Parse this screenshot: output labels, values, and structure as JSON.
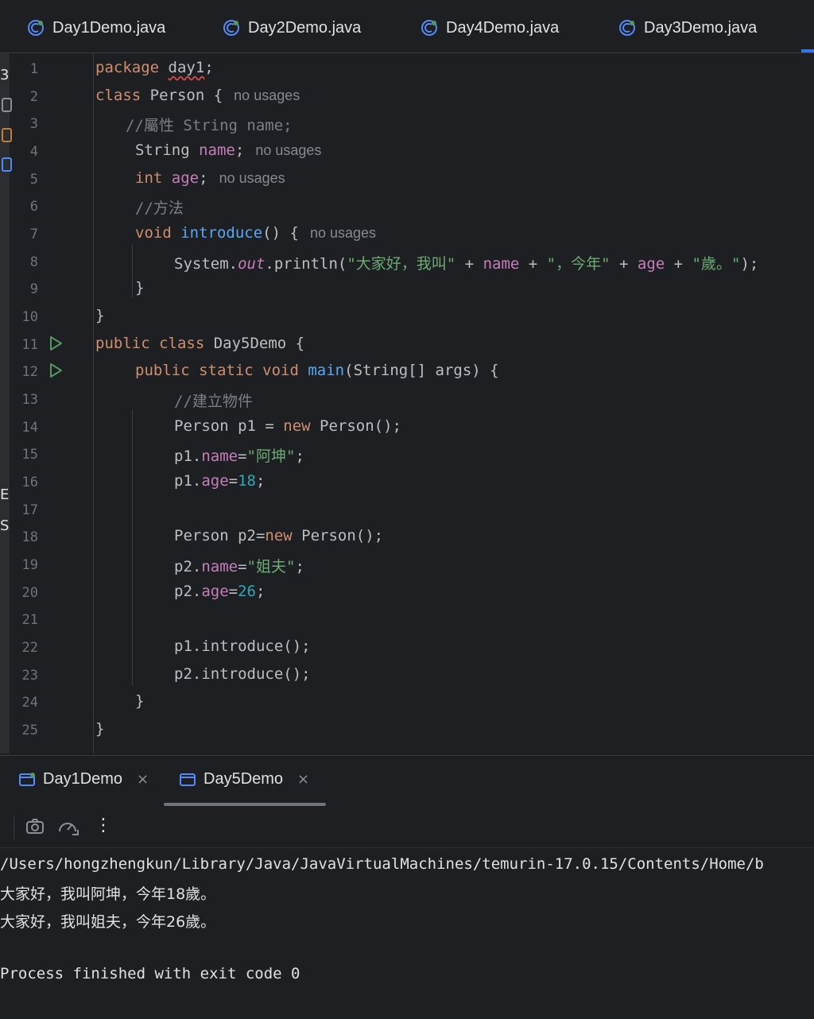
{
  "editor_tabs": [
    {
      "label": "Day1Demo.java"
    },
    {
      "label": "Day2Demo.java"
    },
    {
      "label": "Day4Demo.java"
    },
    {
      "label": "Day3Demo.java"
    }
  ],
  "left_strip": [
    "3",
    "E",
    "S"
  ],
  "code": {
    "line_numbers": [
      "1",
      "2",
      "3",
      "4",
      "5",
      "6",
      "7",
      "8",
      "9",
      "10",
      "11",
      "12",
      "13",
      "14",
      "15",
      "16",
      "17",
      "18",
      "19",
      "20",
      "21",
      "22",
      "23",
      "24",
      "25"
    ],
    "l1": {
      "kw": "package",
      "pkg": "day1",
      "end": ";"
    },
    "l2": {
      "kw": "class",
      "name": "Person {",
      "hint": "no usages"
    },
    "l3": {
      "comment": "//屬性 String name;"
    },
    "l4": {
      "type": "String",
      "field": "name",
      "end": ";",
      "hint": "no usages"
    },
    "l5": {
      "type": "int",
      "field": "age",
      "end": ";",
      "hint": "no usages"
    },
    "l6": {
      "comment": "//方法"
    },
    "l7": {
      "kw": "void",
      "method": "introduce",
      "rest": "() {",
      "hint": "no usages"
    },
    "l8": {
      "sys": "System.",
      "out": "out",
      "println": ".println(",
      "s1": "\"大家好，我叫\"",
      "plus1": " + ",
      "f1": "name",
      "plus2": " + ",
      "s2": "\"，今年\"",
      "plus3": " + ",
      "f2": "age",
      "plus4": " + ",
      "s3": "\"歲。\"",
      "end": ");"
    },
    "l9": {
      "text": "}"
    },
    "l10": {
      "text": "}"
    },
    "l11": {
      "kw": "public class",
      "name": "Day5Demo {"
    },
    "l12": {
      "kw": "public static void",
      "method": "main",
      "rest": "(String[] args) {"
    },
    "l13": {
      "comment": "//建立物件"
    },
    "l14": {
      "a": "Person p1 = ",
      "kw": "new",
      "b": " Person();"
    },
    "l15": {
      "a": "p1.",
      "field": "name",
      "eq": "=",
      "str": "\"阿坤\"",
      "end": ";"
    },
    "l16": {
      "a": "p1.",
      "field": "age",
      "eq": "=",
      "num": "18",
      "end": ";"
    },
    "l18": {
      "a": "Person p2=",
      "kw": "new",
      "b": " Person();"
    },
    "l19": {
      "a": "p2.",
      "field": "name",
      "eq": "=",
      "str": "\"姐夫\"",
      "end": ";"
    },
    "l20": {
      "a": "p2.",
      "field": "age",
      "eq": "=",
      "num": "26",
      "end": ";"
    },
    "l22": {
      "text": "p1.introduce();"
    },
    "l23": {
      "text": "p2.introduce();"
    },
    "l24": {
      "text": "}"
    },
    "l25": {
      "text": "}"
    }
  },
  "run_tabs": [
    {
      "label": "Day1Demo"
    },
    {
      "label": "Day5Demo"
    }
  ],
  "run_tab_close": "×",
  "toolbar": {
    "more": "⋮"
  },
  "console": {
    "cmd": "/Users/hongzhengkun/Library/Java/JavaVirtualMachines/temurin-17.0.15/Contents/Home/b",
    "out1": "大家好，我叫阿坤，今年18歲。",
    "out2": "大家好，我叫姐夫，今年26歲。",
    "exit": "Process finished with exit code 0"
  },
  "colors": {
    "accent": "#3574f0",
    "run_green": "#57965c",
    "keyword": "#cf8e6d",
    "string": "#6aab73"
  }
}
